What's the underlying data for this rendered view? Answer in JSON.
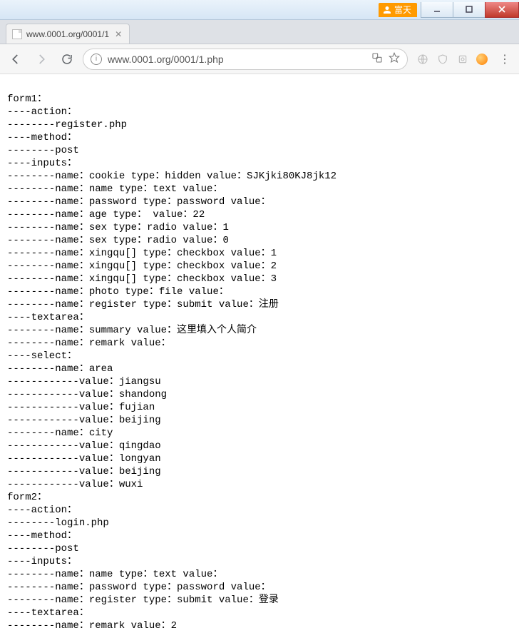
{
  "window": {
    "user_badge": "富天"
  },
  "tab": {
    "title": "www.0001.org/0001/1"
  },
  "toolbar": {
    "url": "www.0001.org/0001/1.php"
  },
  "page_text": {
    "l01": "form1：",
    "l02": "----action：",
    "l03": "--------register.php",
    "l04": "----method：",
    "l05": "--------post",
    "l06": "----inputs：",
    "l07": "--------name：cookie type：hidden value：SJKjki80KJ8jk12",
    "l08": "--------name：name type：text value：",
    "l09": "--------name：password type：password value：",
    "l10": "--------name：age type： value：22",
    "l11": "--------name：sex type：radio value：1",
    "l12": "--------name：sex type：radio value：0",
    "l13": "--------name：xingqu[] type：checkbox value：1",
    "l14": "--------name：xingqu[] type：checkbox value：2",
    "l15": "--------name：xingqu[] type：checkbox value：3",
    "l16": "--------name：photo type：file value：",
    "l17": "--------name：register type：submit value：注册",
    "l18": "----textarea：",
    "l19": "--------name：summary value：这里填入个人简介",
    "l20": "--------name：remark value：",
    "l21": "----select：",
    "l22": "--------name：area",
    "l23": "------------value：jiangsu",
    "l24": "------------value：shandong",
    "l25": "------------value：fujian",
    "l26": "------------value：beijing",
    "l27": "--------name：city",
    "l28": "------------value：qingdao",
    "l29": "------------value：longyan",
    "l30": "------------value：beijing",
    "l31": "------------value：wuxi",
    "l32": "form2：",
    "l33": "----action：",
    "l34": "--------login.php",
    "l35": "----method：",
    "l36": "--------post",
    "l37": "----inputs：",
    "l38": "--------name：name type：text value：",
    "l39": "--------name：password type：password value：",
    "l40": "--------name：register type：submit value：登录",
    "l41": "----textarea：",
    "l42": "--------name：remark value：2"
  }
}
